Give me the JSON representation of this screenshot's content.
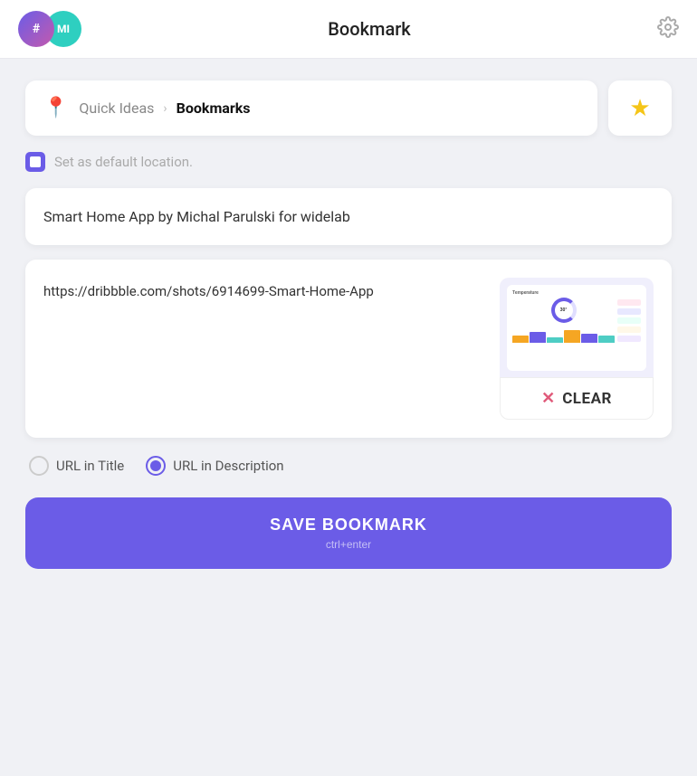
{
  "header": {
    "title": "Bookmark",
    "avatar1_label": "#",
    "avatar2_label": "MI"
  },
  "breadcrumb": {
    "inactive": "Quick Ideas",
    "active": "Bookmarks"
  },
  "default_location": {
    "label": "Set as default location."
  },
  "title_card": {
    "text": "Smart Home App by Michal Parulski for widelab"
  },
  "url_card": {
    "url": "https://dribbble.com/shots/6914699-Smart-Home-App"
  },
  "clear_button": {
    "label": "CLEAR"
  },
  "radio_options": {
    "option1": "URL in Title",
    "option2": "URL in Description",
    "selected": "option2"
  },
  "save_button": {
    "label": "SAVE BOOKMARK",
    "hint": "ctrl+enter"
  },
  "colors": {
    "accent": "#6b5ce7",
    "star": "#f5c518",
    "clear_x": "#e05a7a"
  }
}
